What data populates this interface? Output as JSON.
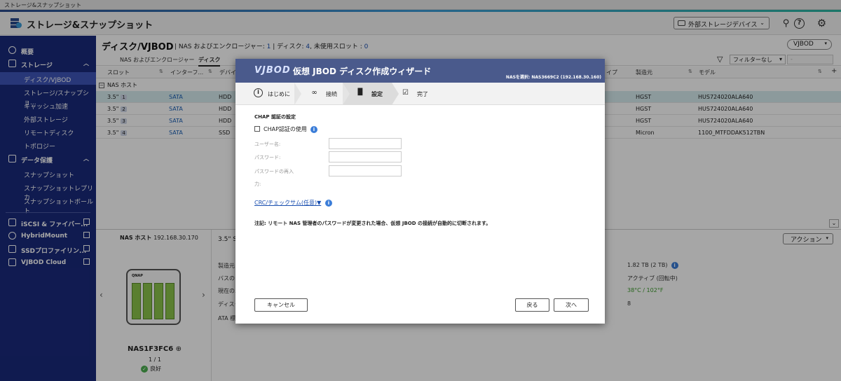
{
  "window": {
    "title": "ストレージ&スナップショット"
  },
  "header": {
    "app_title": "ストレージ&スナップショット",
    "external_devices_label": "外部ストレージデバイス"
  },
  "sidebar": {
    "overview": "概要",
    "storage": "ストレージ",
    "storage_items": [
      "ディスク/VJBOD",
      "ストレージ/スナップショ...",
      "キャッシュ加速",
      "外部ストレージ",
      "リモートディスク",
      "トポロジー"
    ],
    "data_protection": "データ保護",
    "data_protection_items": [
      "スナップショット",
      "スナップショットレプリカ",
      "スナップショットボールト"
    ],
    "links": [
      "iSCSI & ファイバー...",
      "HybridMount",
      "SSDプロファイリン...",
      "VJBOD Cloud"
    ]
  },
  "main": {
    "page_title": "ディスク/VJBOD",
    "meta_prefix": "NAS およびエンクロージャー: ",
    "meta_nas_count": "1",
    "meta_disk_label": " | ディスク: ",
    "meta_disk_count": "4",
    "meta_slot_label": ", 未使用スロット : ",
    "meta_slot_count": "0",
    "vjbod_button": "VJBOD",
    "tabs": [
      "NAS およびエンクロージャー",
      "ディスク"
    ],
    "filter_label": "フィルターなし",
    "filter_second": "-",
    "columns": [
      "スロット",
      "インターフ...",
      "デバイ",
      "イプ",
      "製造元",
      "モデル"
    ],
    "group_label": "NAS ホスト",
    "rows": [
      {
        "slot": "3.5\"",
        "num": "1",
        "iface": "SATA",
        "dev": "HDD",
        "maker": "HGST",
        "model": "HUS724020ALA640"
      },
      {
        "slot": "3.5\"",
        "num": "2",
        "iface": "SATA",
        "dev": "HDD",
        "maker": "HGST",
        "model": "HUS724020ALA640"
      },
      {
        "slot": "3.5\"",
        "num": "3",
        "iface": "SATA",
        "dev": "HDD",
        "maker": "HGST",
        "model": "HUS724020ALA640"
      },
      {
        "slot": "3.5\"",
        "num": "4",
        "iface": "SATA",
        "dev": "SSD",
        "maker": "Micron",
        "model": "1100_MTFDDAK512TBN"
      }
    ]
  },
  "detail": {
    "nas_host_label": "NAS ホスト",
    "nas_host_ip": "192.168.30.170",
    "device_brand": "QNAP",
    "device_name": "NAS1F3FC6",
    "device_count": "1 / 1",
    "device_status": "良好",
    "title": "3.5\" SA",
    "labels": [
      "製造元 :",
      "バスのタ",
      "現在のユ",
      "ディスク",
      "ATA 標準"
    ],
    "capacity": "1.82 TB (2 TB)",
    "status": "アクティブ (回転中)",
    "temperature": "38°C / 102°F",
    "value_8": "8",
    "action_button": "アクション"
  },
  "modal": {
    "logo": "VJBOD",
    "title": "仮想 JBOD ディスク作成ウィザード",
    "subtitle": "NASを選択: NAS3669C2 (192.168.30.160)",
    "steps": [
      "はじめに",
      "接続",
      "設定",
      "完了"
    ],
    "section_title": "CHAP 認証の設定",
    "chap_checkbox": "CHAP認証の使用",
    "username_label": "ユーザー名:",
    "password_label": "パスワード:",
    "password_confirm_label_1": "パスワードの再入",
    "password_confirm_label_2": "力:",
    "crc_link": "CRC/チェックサム(任意)▼",
    "note": "注記: リモート NAS 管理者のパスワードが変更された場合、仮想 JBOD の接続が自動的に切断されます。",
    "cancel": "キャンセル",
    "back": "戻る",
    "next": "次へ"
  },
  "colors": {
    "sidebar": "#1a2a7c",
    "sidebar_active": "#3e55b8",
    "modal_header": "#4a5a8c",
    "row_selected": "#d8edf0"
  }
}
